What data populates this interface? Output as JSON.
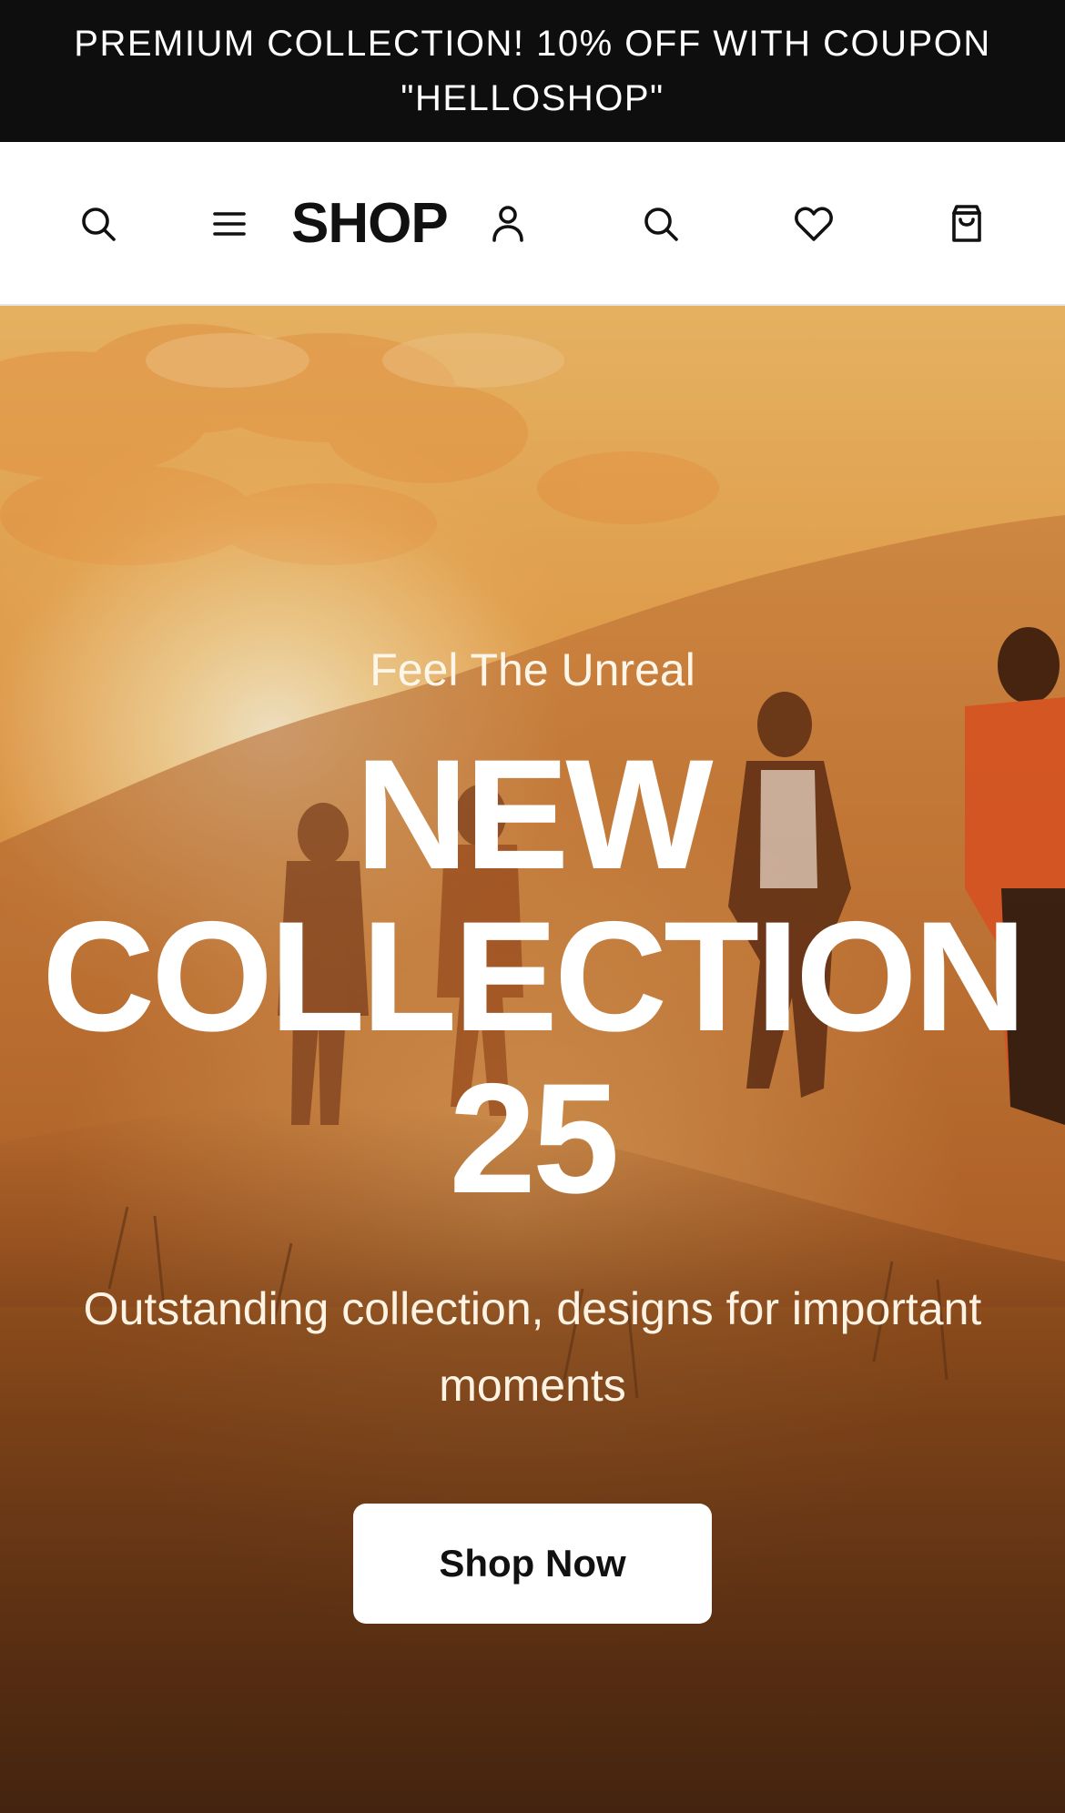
{
  "announcement": {
    "text": "PREMIUM COLLECTION! 10% OFF WITH COUPON \"HELLOSHOP\""
  },
  "header": {
    "logo": "SHOP",
    "icons": [
      "search-icon",
      "menu-icon",
      "user-icon",
      "search-icon",
      "heart-icon",
      "bag-icon"
    ]
  },
  "hero": {
    "eyebrow": "Feel The Unreal",
    "headline_line1": "NEW",
    "headline_line2": "COLLECTION",
    "headline_line3": "25",
    "subcopy": "Outstanding collection, designs for important moments",
    "cta_label": "Shop Now"
  },
  "colors": {
    "announcement_bg": "#0e0e0e",
    "header_bg": "#ffffff",
    "cta_bg": "#ffffff",
    "hero_accent": "#e39a47"
  }
}
